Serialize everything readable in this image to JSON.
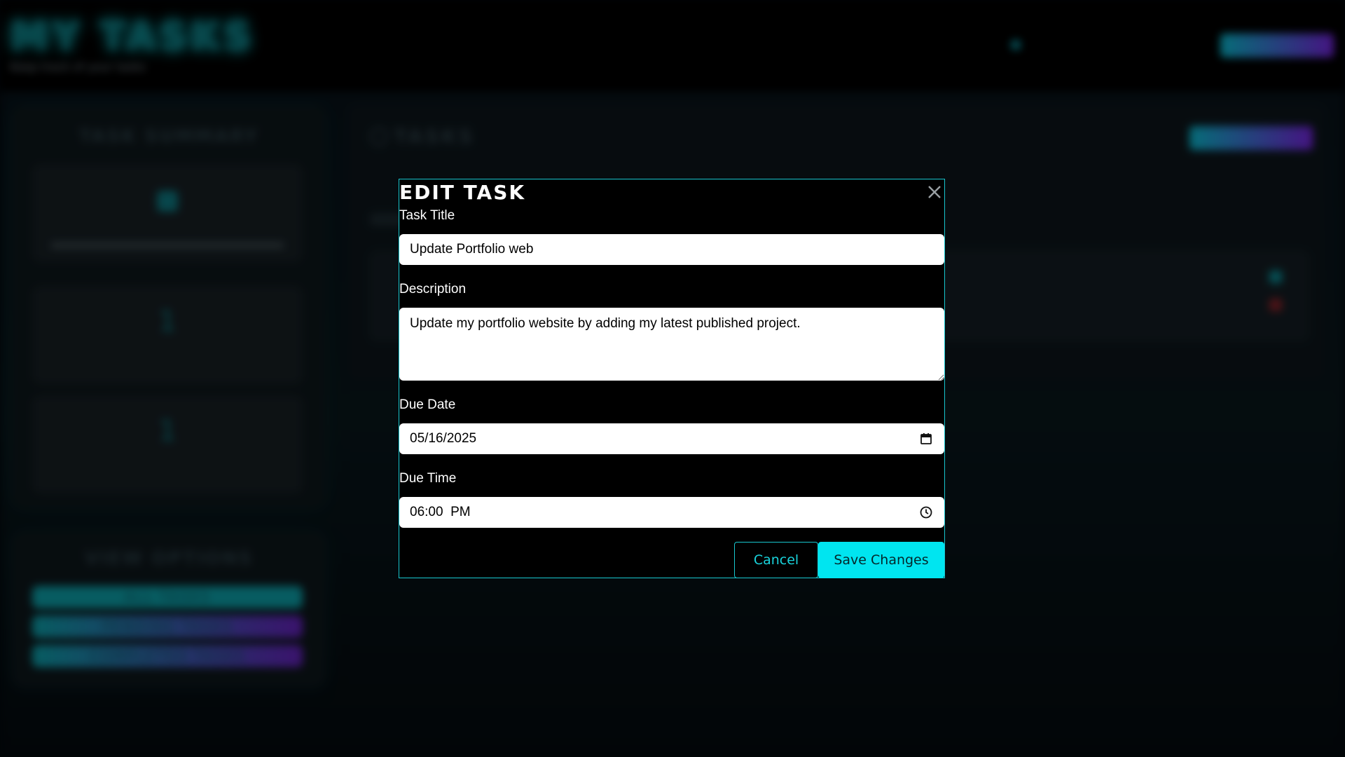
{
  "app": {
    "title": "MY TASKS",
    "badge": "",
    "subtitle": "Keep track of your tasks",
    "user_email": "",
    "signout_label": ""
  },
  "sidebar": {
    "summary_heading": "TASK SUMMARY",
    "stats": [
      {
        "value": "",
        "label": ""
      },
      {
        "value": "1",
        "label": ""
      },
      {
        "value": "1",
        "label": ""
      }
    ],
    "options_heading": "VIEW OPTIONS",
    "view_buttons": [
      "ALL TASKS",
      "PENDING TASKS",
      "COMPLETED TASKS"
    ]
  },
  "main": {
    "heading": "TASKS",
    "add_label": ""
  },
  "modal": {
    "title": "EDIT TASK",
    "title_label": "Task Title",
    "title_value": "Update Portfolio web",
    "description_label": "Description",
    "description_value": "Update my portfolio website by adding my latest published project.",
    "due_date_label": "Due Date",
    "due_date_value": "05/16/2025",
    "due_time_label": "Due Time",
    "due_time_value": "06:00  PM",
    "cancel_label": "Cancel",
    "save_label": "Save Changes"
  },
  "colors": {
    "accent": "#18c7cf",
    "save_bg": "#00e5f0",
    "background": "#000000"
  },
  "icons": {
    "close": "close-icon",
    "date": "calendar-icon",
    "time": "clock-icon"
  }
}
